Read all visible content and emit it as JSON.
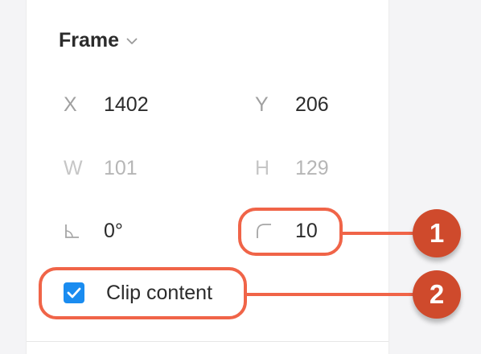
{
  "frame_section": {
    "title": "Frame",
    "fields": {
      "x": {
        "label": "X",
        "value": "1402"
      },
      "y": {
        "label": "Y",
        "value": "206"
      },
      "w": {
        "label": "W",
        "value": "101"
      },
      "h": {
        "label": "H",
        "value": "129"
      },
      "rotation": {
        "icon": "rotation-angle-icon",
        "value": "0°"
      },
      "corner_radius": {
        "icon": "corner-radius-icon",
        "value": "10"
      }
    },
    "clip_content": {
      "label": "Clip content",
      "checked": true
    }
  },
  "annotations": {
    "badge_1": "1",
    "badge_2": "2"
  },
  "colors": {
    "accent": "#1a8cf0",
    "annotation": "#f06448",
    "badge": "#cf4a2c"
  }
}
